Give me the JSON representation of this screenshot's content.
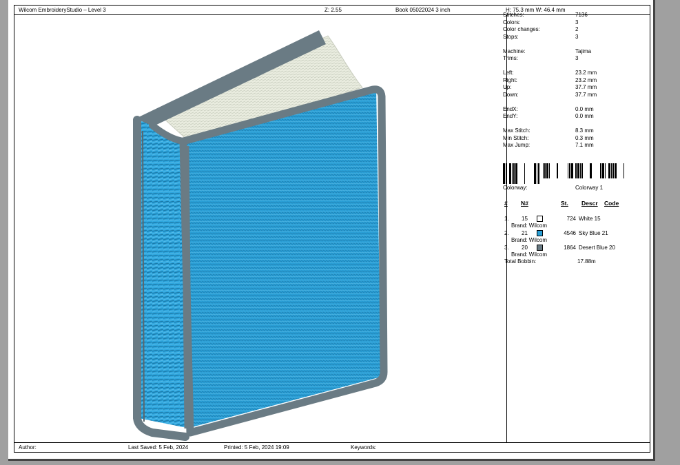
{
  "header": {
    "app_title": "Wilcom EmbroideryStudio – Level 3",
    "zoom": "Z: 2.55",
    "design_name": "Book 05022024 3 inch",
    "dimensions": "H: 75.3 mm   W: 46.4 mm"
  },
  "stats": [
    {
      "label": "Stitches:",
      "value": "7136"
    },
    {
      "label": "Colors:",
      "value": "3"
    },
    {
      "label": "Color changes:",
      "value": "2"
    },
    {
      "label": "Stops:",
      "value": "3"
    },
    null,
    {
      "label": "Machine:",
      "value": "Tajima"
    },
    {
      "label": "Trims:",
      "value": "3"
    },
    null,
    {
      "label": "Left:",
      "value": "23.2 mm"
    },
    {
      "label": "Right:",
      "value": "23.2 mm"
    },
    {
      "label": "Up:",
      "value": "37.7 mm"
    },
    {
      "label": "Down:",
      "value": "37.7 mm"
    },
    null,
    {
      "label": "EndX:",
      "value": "0.0 mm"
    },
    {
      "label": "EndY:",
      "value": "0.0 mm"
    },
    null,
    {
      "label": "Max Stitch:",
      "value": "8.3 mm"
    },
    {
      "label": "Min Stitch:",
      "value": "0.3 mm"
    },
    {
      "label": "Max Jump:",
      "value": "7.1 mm"
    }
  ],
  "colorway": {
    "label": "Colorway:",
    "value": "Colorway 1"
  },
  "thread_table": {
    "headers": {
      "num": "#",
      "thread_no": "N#",
      "stitches": "St.",
      "descr": "Descr",
      "code": "Code"
    },
    "rows": [
      {
        "index": "1.",
        "thread_no": "15",
        "color": "#ffffff",
        "stitches": "724",
        "descr": "White 15",
        "brand": "Brand: Wilcom"
      },
      {
        "index": "2.",
        "thread_no": "21",
        "color": "#2a9fd6",
        "stitches": "4546",
        "descr": "Sky Blue 21",
        "brand": "Brand: Wilcom"
      },
      {
        "index": "3.",
        "thread_no": "20",
        "color": "#687a83",
        "stitches": "1864",
        "descr": "Desert Blue 20",
        "brand": "Brand: Wilcom"
      }
    ],
    "total_bobbin": {
      "label": "Total Bobbin:",
      "value": "17.88m"
    }
  },
  "footer": {
    "author": "Author:",
    "last_saved": "Last Saved:  5 Feb, 2024",
    "printed": "Printed:  5 Feb, 2024 19:09",
    "keywords": "Keywords:"
  },
  "colors": {
    "sky_blue": "#2a9fd6",
    "desert_blue": "#687a83",
    "page_cream": "#e6e9dc"
  }
}
